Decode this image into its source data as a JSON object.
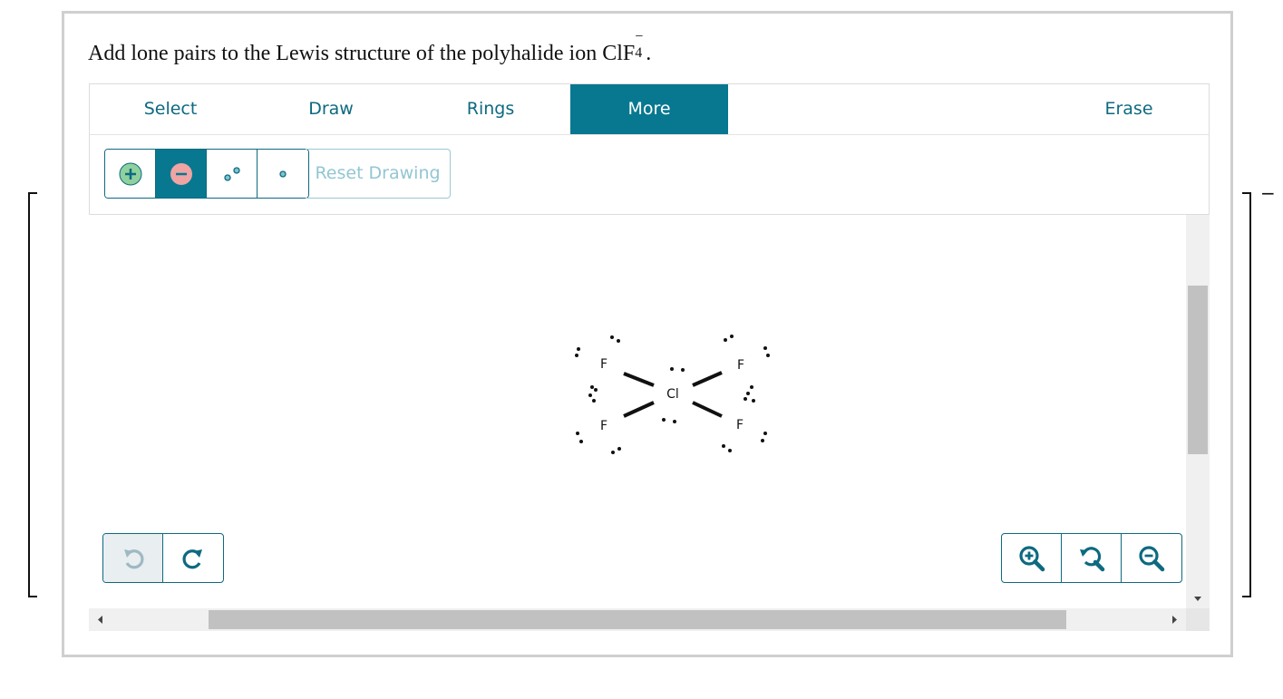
{
  "prompt": {
    "text_before": "Add lone pairs to the Lewis structure of the polyhalide ion ClF",
    "subscript": "4",
    "superscript": "−",
    "text_after": "."
  },
  "ion_charge": "−",
  "tabs": [
    {
      "label": "Select",
      "active": false
    },
    {
      "label": "Draw",
      "active": false
    },
    {
      "label": "Rings",
      "active": false
    },
    {
      "label": "More",
      "active": true
    },
    {
      "label": "Erase",
      "active": false
    }
  ],
  "tools": {
    "add_lone_pair": "plus-circle-icon",
    "remove_lone_pair": "minus-circle-icon",
    "lone_pair": "electron-pair-icon",
    "single_electron": "single-electron-icon",
    "reset_label": "Reset Drawing"
  },
  "molecule": {
    "atoms": [
      {
        "label": "Cl",
        "role": "central"
      },
      {
        "label": "F",
        "role": "upper-left"
      },
      {
        "label": "F",
        "role": "upper-right"
      },
      {
        "label": "F",
        "role": "lower-left"
      },
      {
        "label": "F",
        "role": "lower-right"
      }
    ],
    "bonds": [
      {
        "from": "Cl",
        "to": "F upper-left",
        "order": 1
      },
      {
        "from": "Cl",
        "to": "F upper-right",
        "order": 1
      },
      {
        "from": "Cl",
        "to": "F lower-left",
        "order": 1
      },
      {
        "from": "Cl",
        "to": "F lower-right",
        "order": 1
      }
    ],
    "lone_pairs": {
      "Cl": 2,
      "F": 3
    }
  },
  "history_buttons": {
    "undo": "undo-icon",
    "redo": "redo-icon"
  },
  "zoom_buttons": {
    "zoom_in": "zoom-in-icon",
    "reset": "zoom-reset-icon",
    "zoom_out": "zoom-out-icon"
  },
  "colors": {
    "accent": "#077890",
    "accent_text": "#0d6a80",
    "disabled_text": "#93c6d2",
    "add_green": "#8fd19e",
    "remove_red": "#f0a4a4"
  }
}
